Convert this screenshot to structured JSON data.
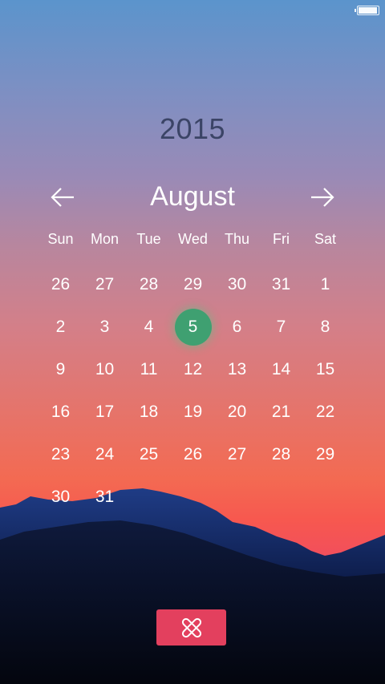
{
  "status_bar": {
    "battery_level": 0.95
  },
  "calendar": {
    "year": "2015",
    "month": "August",
    "weekdays": [
      "Sun",
      "Mon",
      "Tue",
      "Wed",
      "Thu",
      "Fri",
      "Sat"
    ],
    "weeks": [
      [
        "26",
        "27",
        "28",
        "29",
        "30",
        "31",
        "1"
      ],
      [
        "2",
        "3",
        "4",
        "5",
        "6",
        "7",
        "8"
      ],
      [
        "9",
        "10",
        "11",
        "12",
        "13",
        "14",
        "15"
      ],
      [
        "16",
        "17",
        "18",
        "19",
        "20",
        "21",
        "22"
      ],
      [
        "23",
        "24",
        "25",
        "26",
        "27",
        "28",
        "29"
      ],
      [
        "30",
        "31",
        "",
        "",
        "",
        "",
        ""
      ]
    ],
    "selected_day": "5"
  },
  "colors": {
    "selected_day": "#3fa071",
    "close_button": "#e3405e",
    "year_text": "#3b4466"
  },
  "icons": {
    "prev": "arrow-left-icon",
    "next": "arrow-right-icon",
    "close": "close-icon",
    "battery": "battery-icon"
  }
}
